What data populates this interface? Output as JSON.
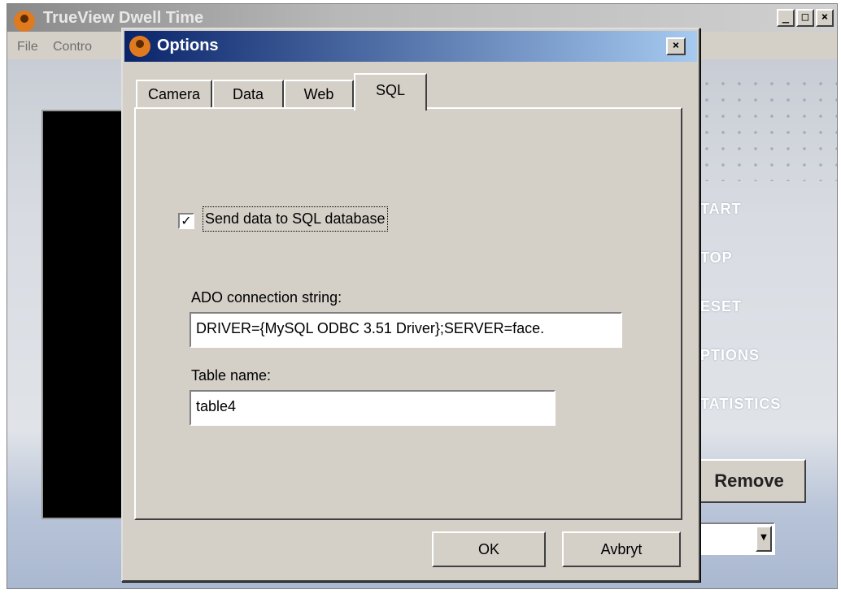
{
  "main_window": {
    "title": "TrueView Dwell Time",
    "menu": [
      "File",
      "Contro"
    ],
    "side_menu": [
      "TART",
      "TOP",
      "ESET",
      "PTIONS",
      "TATISTICS"
    ],
    "remove_label": "Remove",
    "controls": {
      "minimize": "_",
      "maximize": "□",
      "close": "×"
    }
  },
  "dialog": {
    "title": "Options",
    "close": "×",
    "tabs": [
      "Camera",
      "Data",
      "Web",
      "SQL"
    ],
    "active_tab": "SQL",
    "sql": {
      "send_checkbox_label": "Send data to SQL database",
      "send_checked": true,
      "check_mark": "✓",
      "ado_label": "ADO connection string:",
      "ado_value": "DRIVER={MySQL ODBC 3.51 Driver};SERVER=face.",
      "table_label": "Table name:",
      "table_value": "table4"
    },
    "ok_label": "OK",
    "cancel_label": "Avbryt"
  },
  "icons": {
    "app": "trueview-app-icon",
    "combo_arrow": "▼"
  }
}
